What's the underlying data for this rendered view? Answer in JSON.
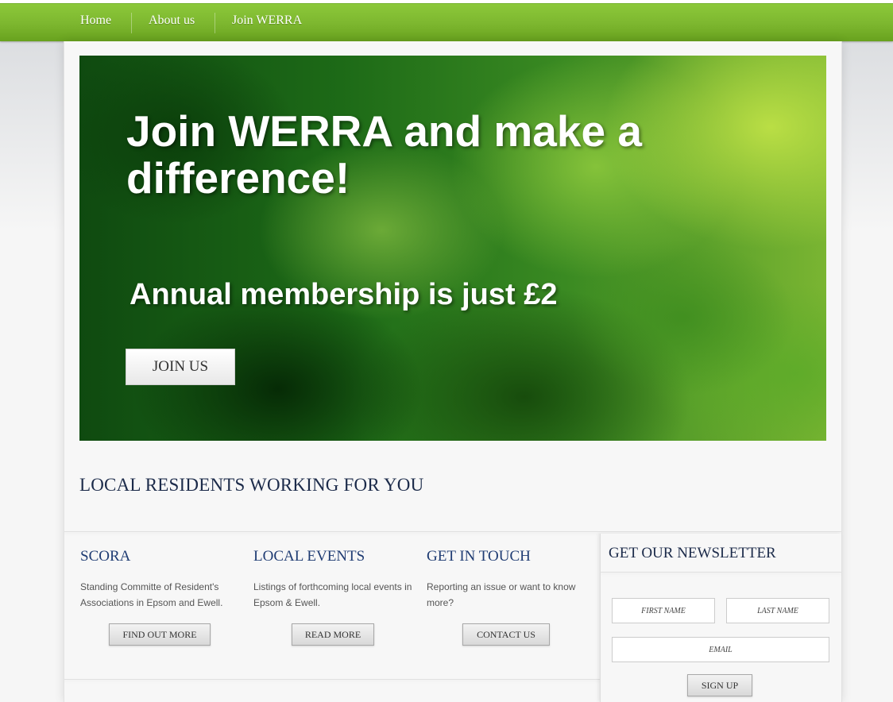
{
  "nav": {
    "items": [
      {
        "label": "Home"
      },
      {
        "label": "About us"
      },
      {
        "label": "Join WERRA"
      }
    ]
  },
  "hero": {
    "title": "Join WERRA and make a difference!",
    "subtitle": "Annual membership is just £2",
    "button_label": "JOIN US"
  },
  "tagline": "LOCAL RESIDENTS WORKING FOR YOU",
  "features": [
    {
      "title": "SCORA",
      "text": "Standing Committe of Resident's Associations in Epsom and Ewell.",
      "button_label": "FIND OUT MORE"
    },
    {
      "title": "LOCAL EVENTS",
      "text": "Listings of forthcoming local events in Epsom & Ewell.",
      "button_label": "READ MORE"
    },
    {
      "title": "GET IN TOUCH",
      "text": "Reporting an issue or want to know more?",
      "button_label": "CONTACT US"
    }
  ],
  "newsletter": {
    "title": "GET OUR NEWSLETTER",
    "first_name_placeholder": "FIRST NAME",
    "last_name_placeholder": "LAST NAME",
    "email_placeholder": "EMAIL",
    "button_label": "SIGN UP"
  },
  "colors": {
    "nav_green": "#7db72f",
    "heading_navy": "#1c2b4a",
    "feature_title_blue": "#1f3c73"
  }
}
